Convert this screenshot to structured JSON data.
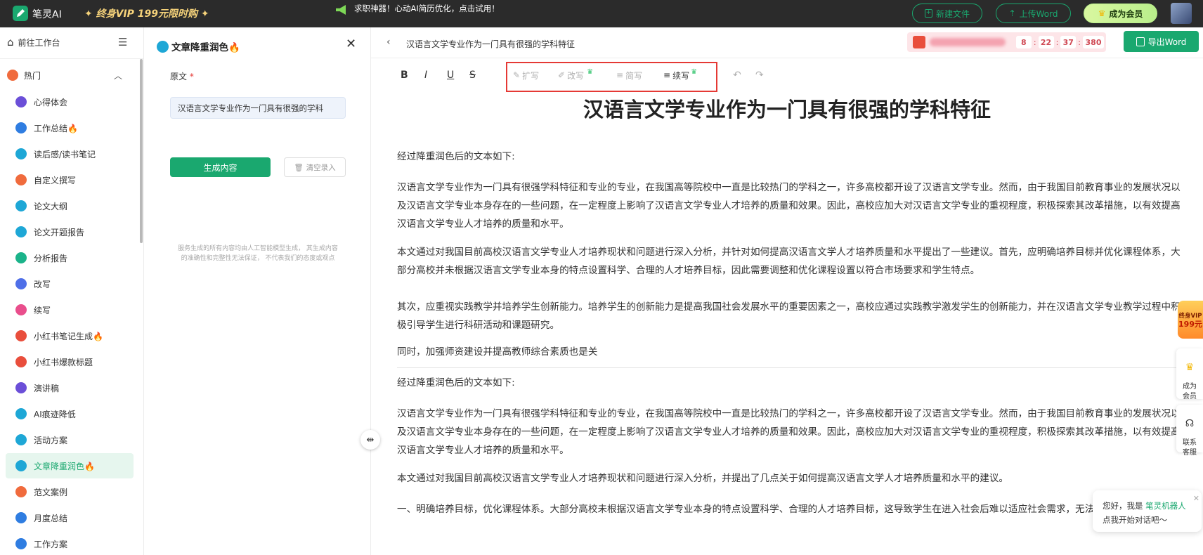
{
  "topbar": {
    "app_name": "笔灵AI",
    "vip_promo": "终身VIP 199元限时购",
    "notice": "求职神器！心动AI简历优化，点击试用！",
    "new_file": "新建文件",
    "upload_word": "上传Word",
    "become_member": "成为会员"
  },
  "sidebar": {
    "workspace": "前往工作台",
    "section": "热门",
    "items": [
      {
        "label": "心得体会",
        "color": "#6b4fd8",
        "icon": "doc-icon"
      },
      {
        "label": "工作总结🔥",
        "color": "#2f7de1",
        "icon": "briefcase-icon"
      },
      {
        "label": "读后感/读书笔记",
        "color": "#1ea7d6",
        "icon": "book-icon"
      },
      {
        "label": "自定义撰写",
        "color": "#f06b3d",
        "icon": "hot-icon"
      },
      {
        "label": "论文大纲",
        "color": "#1ea7d6",
        "icon": "outline-icon"
      },
      {
        "label": "论文开题报告",
        "color": "#1ea7d6",
        "icon": "report-icon"
      },
      {
        "label": "分析报告",
        "color": "#1bb38a",
        "icon": "analysis-icon"
      },
      {
        "label": "改写",
        "color": "#4f6fe8",
        "icon": "rewrite-icon"
      },
      {
        "label": "续写",
        "color": "#e94e8c",
        "icon": "continue-icon"
      },
      {
        "label": "小红书笔记生成🔥",
        "color": "#e94e3c",
        "icon": "xiaohongshu-icon"
      },
      {
        "label": "小红书爆款标题",
        "color": "#e94e3c",
        "icon": "xiaohongshu-icon"
      },
      {
        "label": "演讲稿",
        "color": "#6b4fd8",
        "icon": "speech-icon"
      },
      {
        "label": "AI痕迹降低",
        "color": "#1ea7d6",
        "icon": "ai-icon"
      },
      {
        "label": "活动方案",
        "color": "#1ea7d6",
        "icon": "plan-icon"
      },
      {
        "label": "文章降重润色🔥",
        "color": "#1ea7d6",
        "icon": "polish-icon",
        "active": true
      },
      {
        "label": "范文案例",
        "color": "#f06b3d",
        "icon": "hot-icon"
      },
      {
        "label": "月度总结",
        "color": "#2f7de1",
        "icon": "summary-icon"
      },
      {
        "label": "工作方案",
        "color": "#2f7de1",
        "icon": "work-plan-icon"
      }
    ]
  },
  "form": {
    "title": "文章降重润色🔥",
    "source_label": "原文",
    "required_mark": "*",
    "input_value": "汉语言文学专业作为一门具有很强的学科",
    "generate": "生成内容",
    "clear": "清空录入",
    "disclaimer_1": "服务生成的所有内容均由人工智能模型生成， 其生成内容",
    "disclaimer_2": "的准确性和完整性无法保证， 不代表我们的态度或观点"
  },
  "doc": {
    "breadcrumb": "汉语言文学专业作为一门具有很强的学科特征",
    "countdown": [
      "8",
      "22",
      "37",
      "380"
    ],
    "export": "导出Word",
    "toolbar": {
      "bold": "B",
      "italic": "I",
      "underline": "U",
      "strike": "S",
      "expand": "扩写",
      "rewrite": "改写",
      "simplify": "简写",
      "continue": "续写"
    },
    "heading": "汉语言文学专业作为一门具有很强的学科特征",
    "paragraphs": [
      "经过降重润色后的文本如下:",
      "汉语言文学专业作为一门具有很强学科特征和专业的专业，在我国高等院校中一直是比较热门的学科之一，许多高校都开设了汉语言文学专业。然而，由于我国目前教育事业的发展状况以及汉语言文学专业本身存在的一些问题，在一定程度上影响了汉语言文学专业人才培养的质量和效果。因此，高校应加大对汉语言文学专业的重视程度，积极探索其改革措施，以有效提高汉语言文学专业人才培养的质量和水平。",
      "本文通过对我国目前高校汉语言文学专业人才培养现状和问题进行深入分析，并针对如何提高汉语言文学人才培养质量和水平提出了一些建议。首先，应明确培养目标并优化课程体系，大部分高校并未根据汉语言文学专业本身的特点设置科学、合理的人才培养目标，因此需要调整和优化课程设置以符合市场要求和学生特点。",
      "其次，应重视实践教学并培养学生创新能力。培养学生的创新能力是提高我国社会发展水平的重要因素之一，高校应通过实践教学激发学生的创新能力，并在汉语言文学专业教学过程中积极引导学生进行科研活动和课题研究。",
      "同时，加强师资建设并提高教师综合素质也是关",
      "经过降重润色后的文本如下:",
      "汉语言文学专业作为一门具有很强学科特征和专业的专业，在我国高等院校中一直是比较热门的学科之一，许多高校都开设了汉语言文学专业。然而，由于我国目前教育事业的发展状况以及汉语言文学专业本身存在的一些问题，在一定程度上影响了汉语言文学专业人才培养的质量和效果。因此，高校应加大对汉语言文学专业的重视程度，积极探索其改革措施，以有效提高汉语言文学专业人才培养的质量和水平。",
      "本文通过对我国目前高校汉语言文学专业人才培养现状和问题进行深入分析，并提出了几点关于如何提高汉语言文学人才培养质量和水平的建议。",
      "一、明确培养目标，优化课程体系。大部分高校未根据汉语言文学专业本身的特点设置科学、合理的人才培养目标，这导致学生在进入社会后难以适应社会需求，无法满"
    ]
  },
  "float": {
    "vip_badge": "终身VIP",
    "vip_price": "199元",
    "member": "成为\n会员",
    "service": "联系\n客服",
    "chat_prefix": "您好，我是 ",
    "chat_name": "笔灵机器人",
    "chat_line2": "点我开始对话吧～"
  },
  "colors": {
    "accent": "#1aa86f",
    "highlight_box": "#e53935"
  }
}
